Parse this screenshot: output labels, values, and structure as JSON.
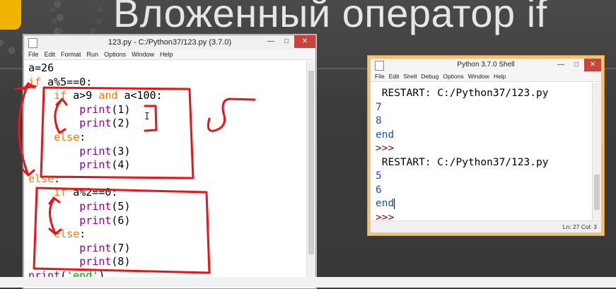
{
  "slide": {
    "title": "Вложенный оператор if"
  },
  "editor": {
    "window_title": "123.py - C:/Python37/123.py (3.7.0)",
    "menu": [
      "File",
      "Edit",
      "Format",
      "Run",
      "Options",
      "Window",
      "Help"
    ],
    "code_lines": [
      "a=26",
      "if a%5==0:",
      "    if a>9 and a<100:",
      "        print(1)",
      "        print(2)",
      "    else:",
      "        print(3)",
      "        print(4)",
      "else:",
      "    if a%2==0:",
      "        print(5)",
      "        print(6)",
      "    else:",
      "        print(7)",
      "        print(8)",
      "print('end')"
    ]
  },
  "shell": {
    "window_title": "Python 3.7.0 Shell",
    "menu": [
      "File",
      "Edit",
      "Shell",
      "Debug",
      "Options",
      "Window",
      "Help"
    ],
    "lines": [
      " RESTART: C:/Python37/123.py",
      "7",
      "8",
      "end",
      ">>>",
      " RESTART: C:/Python37/123.py",
      "5",
      "6",
      "end",
      ">>>"
    ],
    "status": "Ln: 27  Col: 3"
  },
  "colors": {
    "keyword": "#ff7700",
    "builtin": "#900090",
    "string": "#00aa00",
    "shell_output": "#1f50c8",
    "ink": "#e8141a"
  }
}
